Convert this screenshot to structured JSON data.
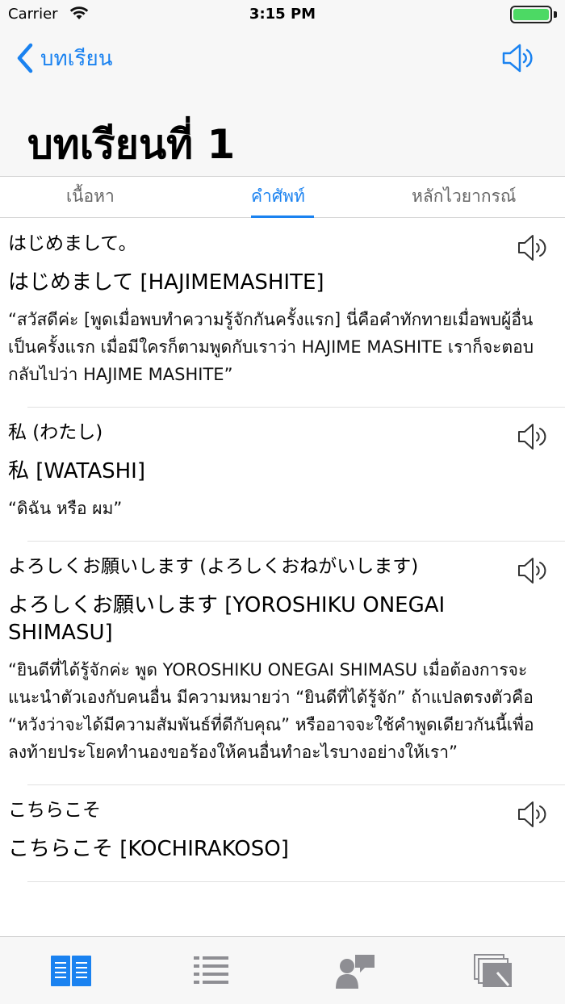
{
  "status_bar": {
    "carrier": "Carrier",
    "time": "3:15 PM"
  },
  "nav": {
    "back_label": "บทเรียน",
    "speaker_icon": "speaker-icon"
  },
  "page_title": "บทเรียนที่ 1",
  "tabs": [
    {
      "label": "เนื้อหา",
      "active": false
    },
    {
      "label": "คำศัพท์",
      "active": true
    },
    {
      "label": "หลักไวยากรณ์",
      "active": false
    }
  ],
  "entries": [
    {
      "head": "はじめまして。",
      "reading": "はじめまして [HAJIMEMASHITE]",
      "meaning": "“สวัสดีค่ะ [พูดเมื่อพบทำความรู้จักกันครั้งแรก] นี่คือคำทักทายเมื่อพบผู้อื่นเป็นครั้งแรก เมื่อมีใครก็ตามพูดกับเราว่า HAJIME MASHITE เราก็จะตอบกลับไปว่า HAJIME MASHITE”"
    },
    {
      "head": "私 (わたし)",
      "reading": "私 [WATASHI]",
      "meaning": "“ดิฉัน หรือ ผม”"
    },
    {
      "head": "よろしくお願いします (よろしくおねがいします)",
      "reading": "よろしくお願いします [YOROSHIKU ONEGAI SHIMASU]",
      "meaning": "“ยินดีที่ได้รู้จักค่ะ พูด YOROSHIKU ONEGAI SHIMASU เมื่อต้องการจะแนะนำตัวเองกับคนอื่น มีความหมายว่า “ยินดีที่ได้รู้จัก” ถ้าแปลตรงตัวคือ “หวังว่าจะได้มีความสัมพันธ์ที่ดีกับคุณ” หรืออาจจะใช้คำพูดเดียวกันนี้เพื่อลงท้ายประโยคทำนองขอร้องให้คนอื่นทำอะไรบางอย่างให้เรา”"
    },
    {
      "head": "こちらこそ",
      "reading": "こちらこそ [KOCHIRAKOSO]",
      "meaning": ""
    }
  ],
  "tabbar": [
    {
      "icon": "book-icon",
      "active": true
    },
    {
      "icon": "list-icon",
      "active": false
    },
    {
      "icon": "conversation-icon",
      "active": false
    },
    {
      "icon": "flashcards-icon",
      "active": false
    }
  ],
  "colors": {
    "accent": "#1a82f0",
    "inactive_icon": "#8e8e93",
    "battery": "#4cd964"
  }
}
